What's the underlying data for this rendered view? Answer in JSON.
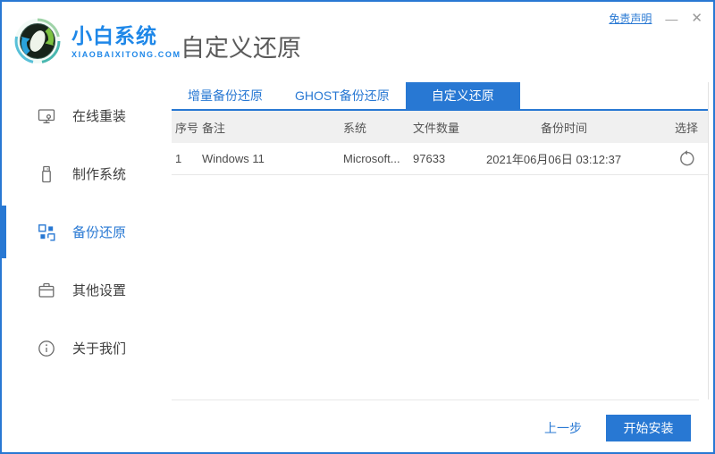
{
  "header": {
    "brand": "小白系统",
    "brand_domain": "XIAOBAIXITONG.COM",
    "page_title": "自定义还原",
    "disclaimer_link": "免责声明",
    "minimize_glyph": "—",
    "close_glyph": "✕",
    "logo_icon": "recycle-sphere-logo-icon"
  },
  "sidebar": {
    "items": [
      {
        "label": "在线重装",
        "icon": "monitor-icon",
        "active": false
      },
      {
        "label": "制作系统",
        "icon": "usb-drive-icon",
        "active": false
      },
      {
        "label": "备份还原",
        "icon": "grid-blocks-icon",
        "active": true
      },
      {
        "label": "其他设置",
        "icon": "briefcase-icon",
        "active": false
      },
      {
        "label": "关于我们",
        "icon": "info-circle-icon",
        "active": false
      }
    ]
  },
  "tabs": [
    {
      "label": "增量备份还原",
      "active": false
    },
    {
      "label": "GHOST备份还原",
      "active": false
    },
    {
      "label": "自定义还原",
      "active": true
    }
  ],
  "table": {
    "headers": [
      "序号",
      "备注",
      "系统",
      "文件数量",
      "备份时间",
      "选择"
    ],
    "rows": [
      {
        "index": "1",
        "note": "Windows 11",
        "system": "Microsoft...",
        "file_count": "97633",
        "backup_time": "2021年06月06日 03:12:37",
        "action_icon": "restore-history-icon"
      }
    ]
  },
  "footer": {
    "back_label": "上一步",
    "install_label": "开始安装"
  },
  "colors": {
    "accent": "#2878d3",
    "logo_blue": "#1e87e8",
    "table_header_bg": "#f0f0f0",
    "border_blue": "#2878d3"
  }
}
